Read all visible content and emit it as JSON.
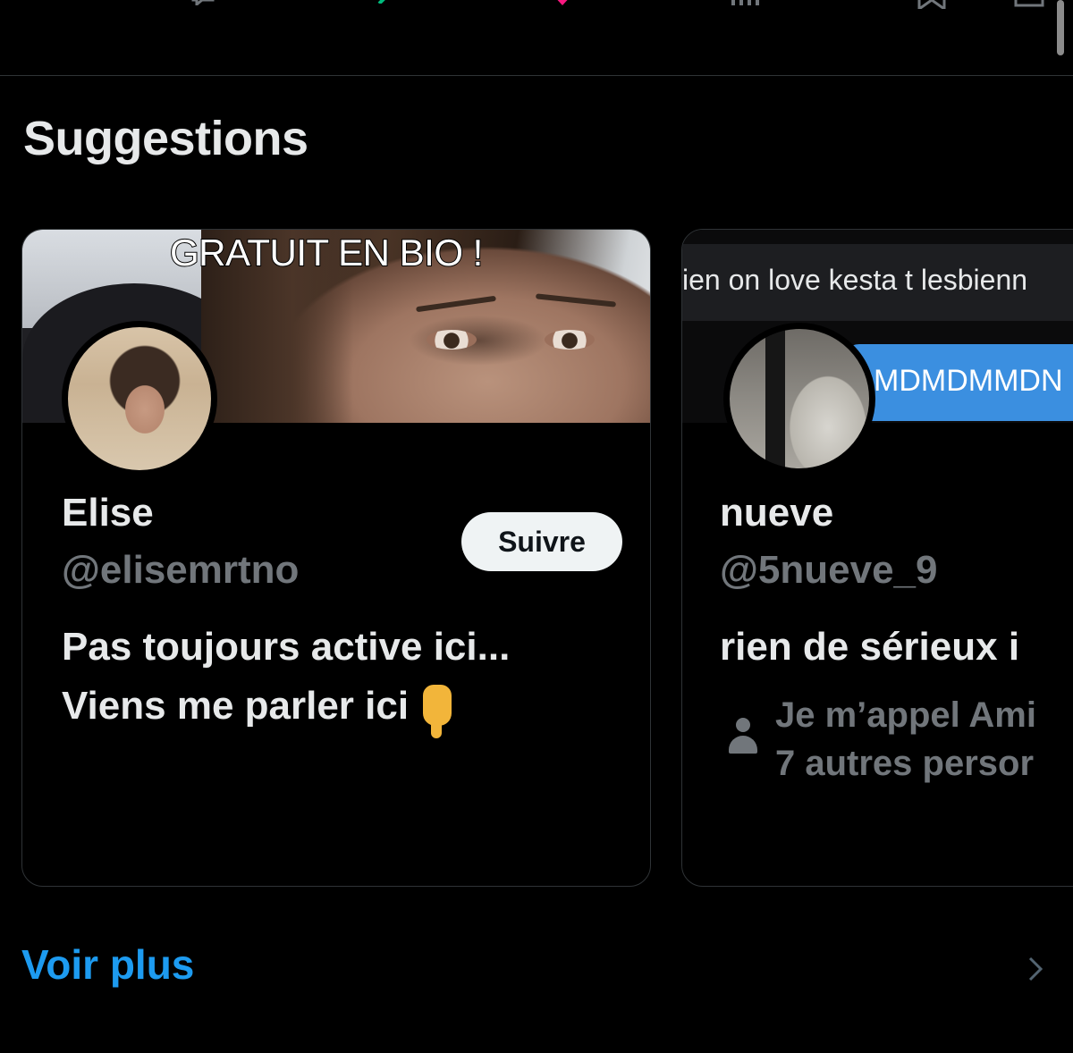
{
  "section": {
    "title": "Suggestions"
  },
  "cards": [
    {
      "banner_text": "GRATUIT EN BIO !",
      "name": "Elise",
      "handle": "@elisemrtno",
      "bio_lines": [
        "Pas toujours active ici...",
        "Viens me parler ici"
      ],
      "bio_emoji": "backhand-index-pointing-down",
      "follow_label": "Suivre"
    },
    {
      "banner_caption": "ien on love kesta t lesbienn",
      "banner_blue_text": "MDMDMMDN",
      "name": "nueve",
      "handle": "@5nueve_9",
      "bio": "rien de sérieux i",
      "followed_by_lines": [
        "Je m’appel Ami",
        "7 autres persor"
      ]
    }
  ],
  "footer": {
    "show_more_label": "Voir plus"
  },
  "colors": {
    "background": "#000000",
    "accent": "#1d9bf0",
    "secondary_text": "#71767b",
    "primary_text": "#e7e9ea"
  },
  "icons": [
    "reply-icon",
    "repost-icon",
    "like-icon",
    "views-icon",
    "bookmark-icon",
    "share-icon",
    "person-icon",
    "chevron-right-icon"
  ]
}
